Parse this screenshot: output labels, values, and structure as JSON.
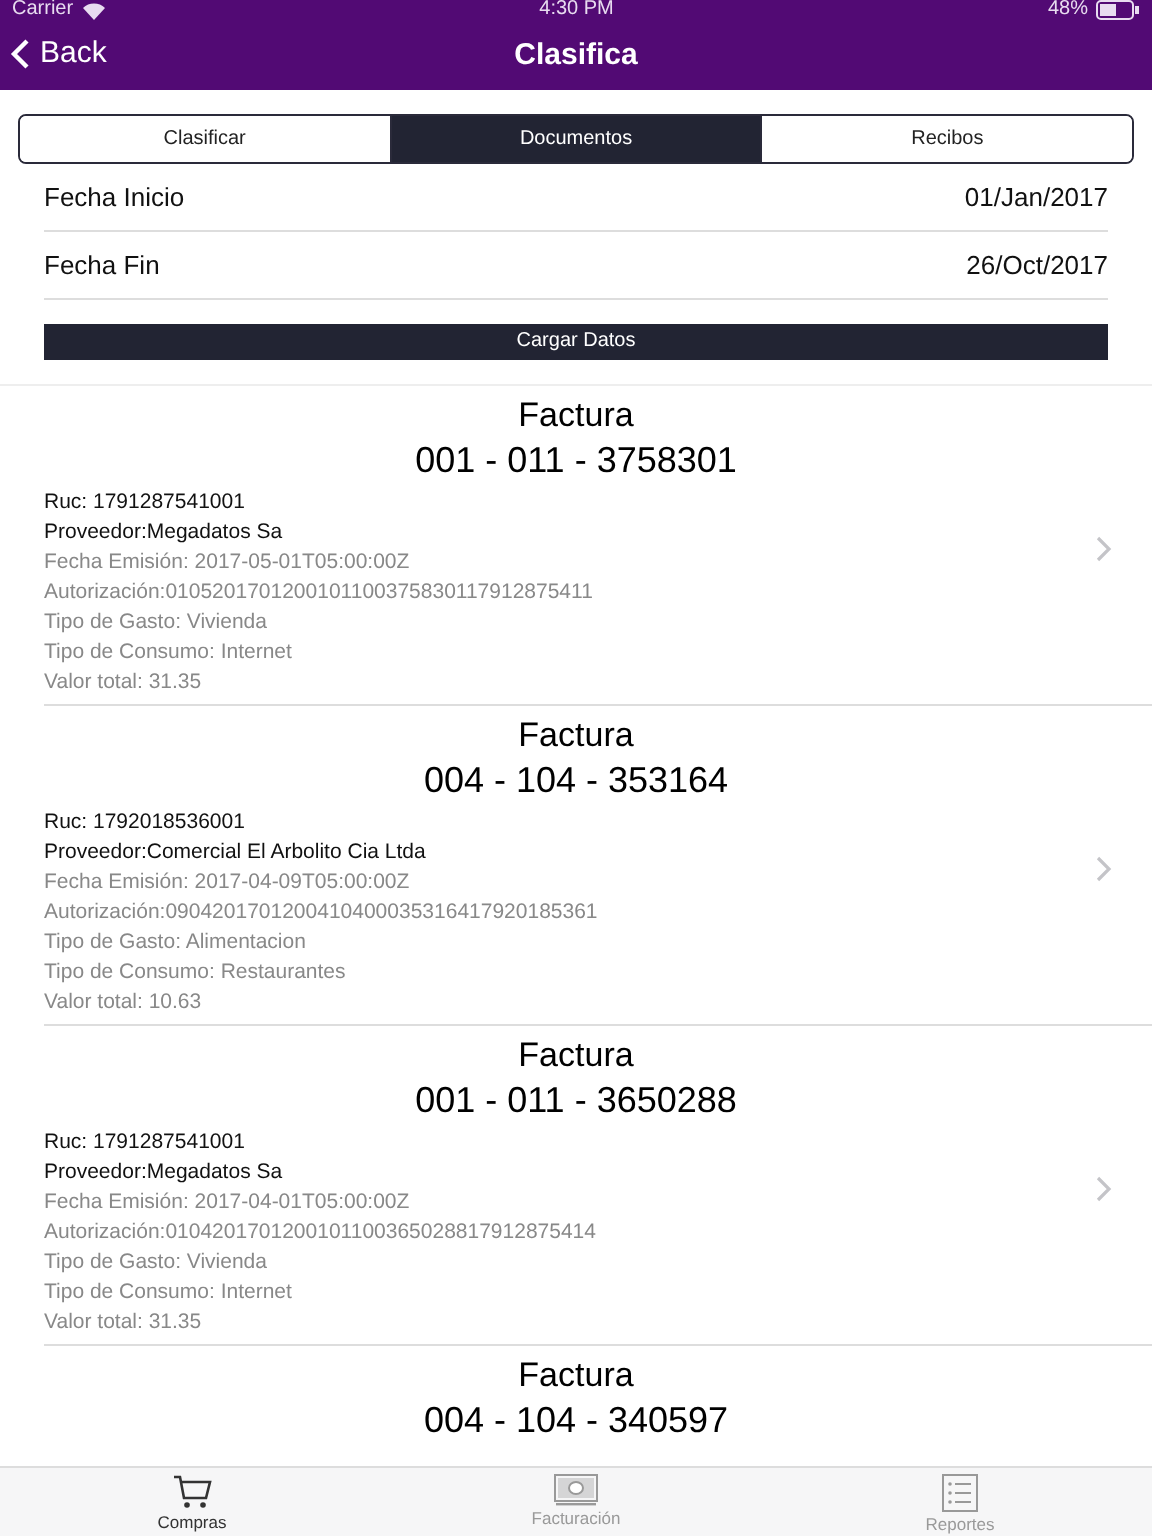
{
  "status_bar": {
    "carrier": "Carrier",
    "time": "4:30 PM",
    "battery": "48%"
  },
  "nav": {
    "back": "Back",
    "title": "Clasifica"
  },
  "segments": [
    {
      "label": "Clasificar",
      "selected": false
    },
    {
      "label": "Documentos",
      "selected": true
    },
    {
      "label": "Recibos",
      "selected": false
    }
  ],
  "date_rows": [
    {
      "label": "Fecha Inicio",
      "value": "01/Jan/2017"
    },
    {
      "label": "Fecha Fin",
      "value": "26/Oct/2017"
    }
  ],
  "load_button": "Cargar Datos",
  "invoices": [
    {
      "type": "Factura",
      "number": "001 - 011 - 3758301",
      "lines": [
        {
          "kind": "primary",
          "text": "Ruc: 1791287541001"
        },
        {
          "kind": "primary",
          "text": "Proveedor:Megadatos Sa"
        },
        {
          "kind": "secondary",
          "text": "Fecha Emisión: 2017-05-01T05:00:00Z"
        },
        {
          "kind": "secondary",
          "text": "Autorización:0105201701200101100375830117912875411"
        },
        {
          "kind": "secondary",
          "text": "Tipo de Gasto: Vivienda"
        },
        {
          "kind": "secondary",
          "text": "Tipo de Consumo: Internet"
        },
        {
          "kind": "secondary",
          "text": "Valor total: 31.35"
        }
      ]
    },
    {
      "type": "Factura",
      "number": "004 - 104 - 353164",
      "lines": [
        {
          "kind": "primary",
          "text": "Ruc: 1792018536001"
        },
        {
          "kind": "primary",
          "text": "Proveedor:Comercial El Arbolito Cia Ltda"
        },
        {
          "kind": "secondary",
          "text": "Fecha Emisión: 2017-04-09T05:00:00Z"
        },
        {
          "kind": "secondary",
          "text": "Autorización:0904201701200410400035316417920185361"
        },
        {
          "kind": "secondary",
          "text": "Tipo de Gasto: Alimentacion"
        },
        {
          "kind": "secondary",
          "text": "Tipo de Consumo: Restaurantes"
        },
        {
          "kind": "secondary",
          "text": "Valor total: 10.63"
        }
      ]
    },
    {
      "type": "Factura",
      "number": "001 - 011 - 3650288",
      "lines": [
        {
          "kind": "primary",
          "text": "Ruc: 1791287541001"
        },
        {
          "kind": "primary",
          "text": "Proveedor:Megadatos Sa"
        },
        {
          "kind": "secondary",
          "text": "Fecha Emisión: 2017-04-01T05:00:00Z"
        },
        {
          "kind": "secondary",
          "text": "Autorización:0104201701200101100365028817912875414"
        },
        {
          "kind": "secondary",
          "text": "Tipo de Gasto: Vivienda"
        },
        {
          "kind": "secondary",
          "text": "Tipo de Consumo: Internet"
        },
        {
          "kind": "secondary",
          "text": "Valor total: 31.35"
        }
      ]
    },
    {
      "type": "Factura",
      "number": "004 - 104 - 340597"
    }
  ],
  "tab_bar": [
    {
      "label": "Compras",
      "kind": "cart",
      "selected": true
    },
    {
      "label": "Facturación",
      "kind": "money",
      "selected": false
    },
    {
      "label": "Reportes",
      "kind": "list",
      "selected": false
    }
  ]
}
